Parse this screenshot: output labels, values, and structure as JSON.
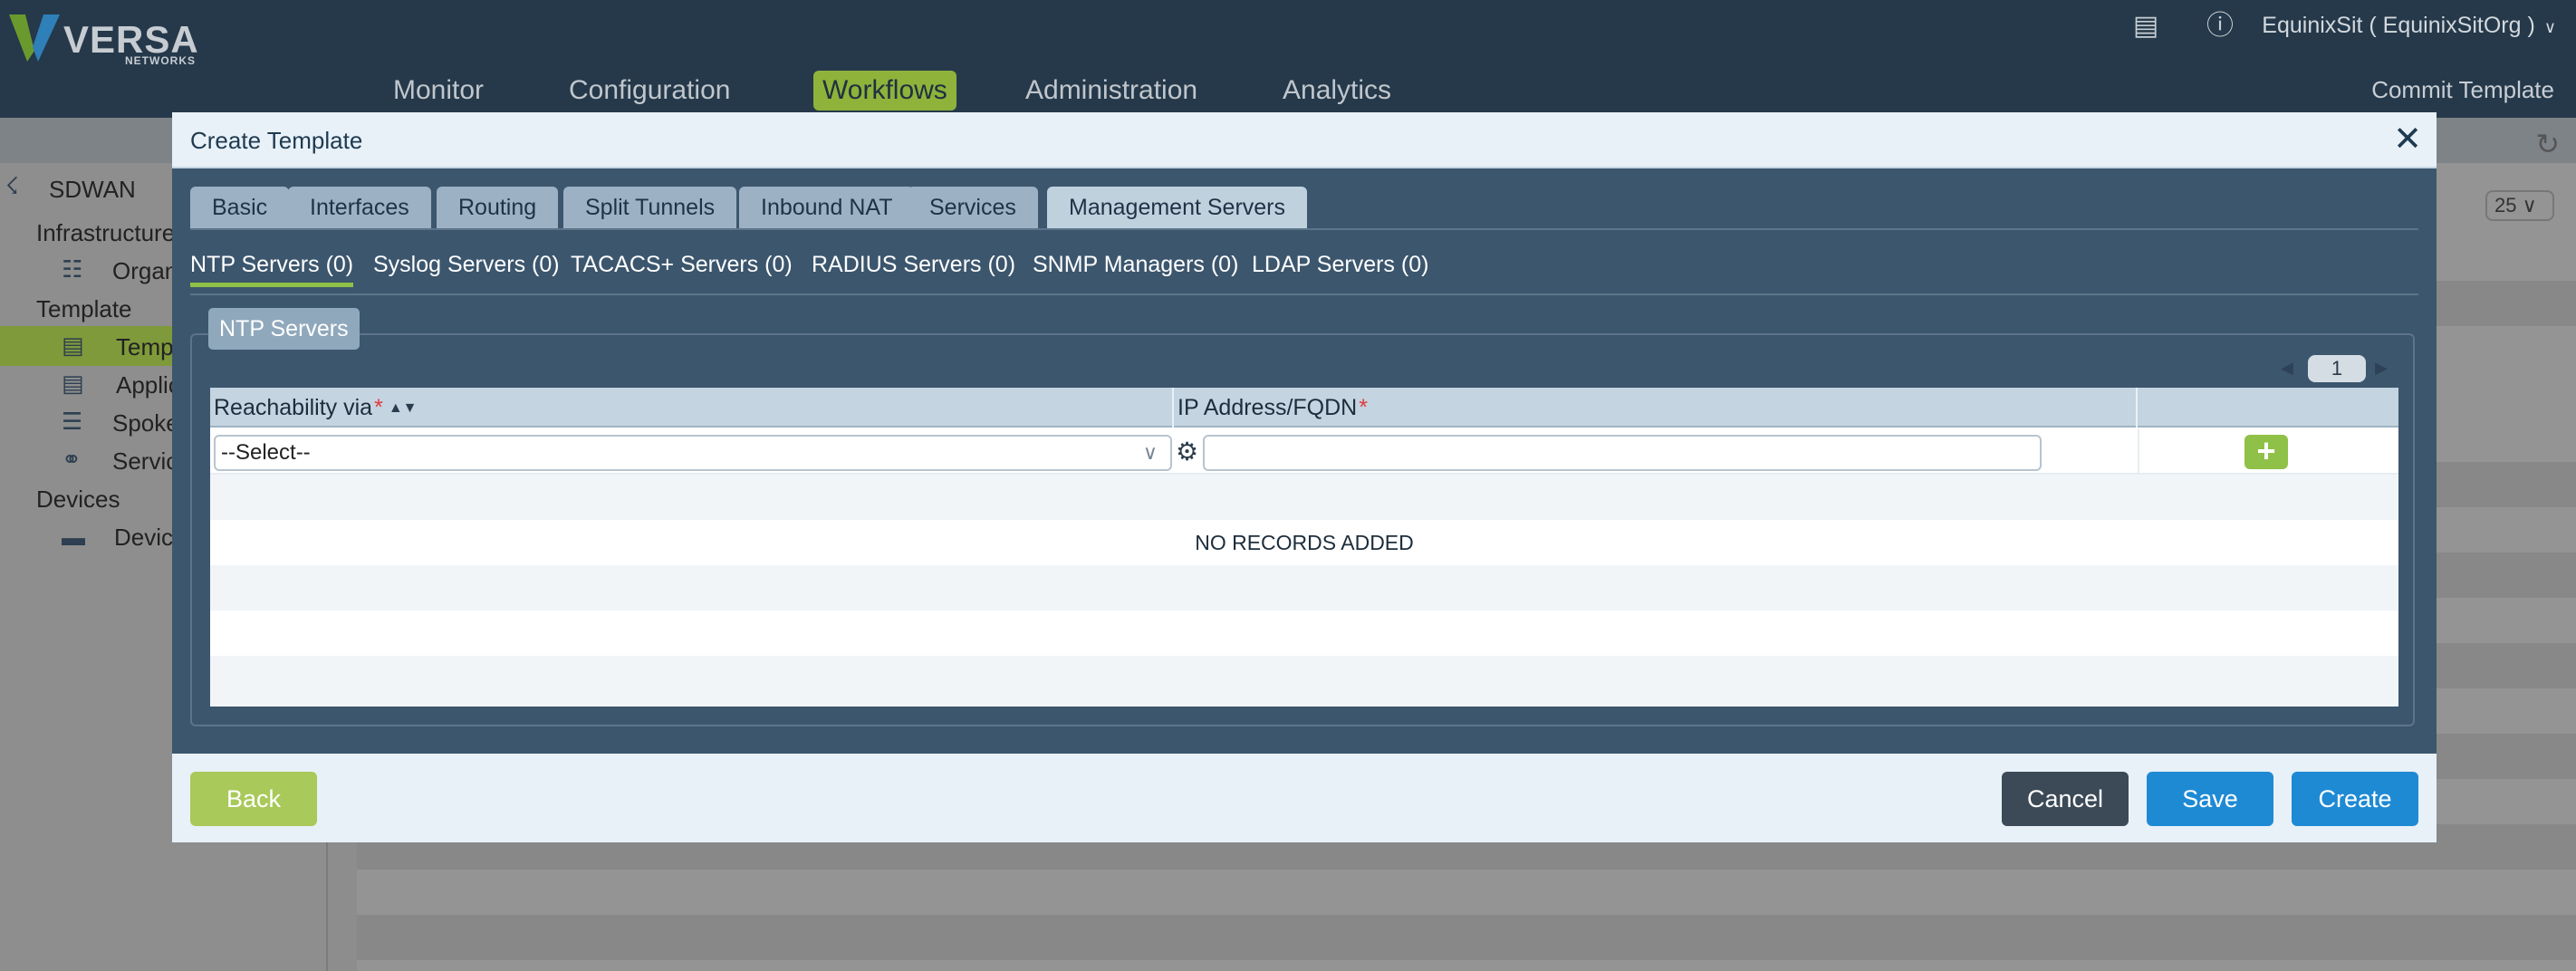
{
  "brand": {
    "name": "VERSA",
    "sub": "NETWORKS"
  },
  "header": {
    "org": "EquinixSit ( EquinixSitOrg )",
    "nav": [
      "Monitor",
      "Configuration",
      "Workflows",
      "Administration",
      "Analytics"
    ],
    "active_nav": "Workflows",
    "commit": "Commit Template"
  },
  "sidebar": {
    "root": "SDWAN",
    "infrastructure": "Infrastructure",
    "organization": "Organ",
    "template": "Template",
    "template_item": "Temp",
    "applic": "Applic",
    "spoke": "Spoke",
    "servic": "Servic",
    "devices": "Devices",
    "device": "Device"
  },
  "background": {
    "page_size": "25"
  },
  "modal": {
    "title": "Create Template",
    "tabs": [
      "Basic",
      "Interfaces",
      "Routing",
      "Split Tunnels",
      "Inbound NAT",
      "Services",
      "Management Servers"
    ],
    "active_tab": "Management Servers",
    "subtabs": [
      "NTP Servers (0)",
      "Syslog Servers (0)",
      "TACACS+ Servers (0)",
      "RADIUS Servers (0)",
      "SNMP Managers (0)",
      "LDAP Servers (0)"
    ],
    "active_subtab": "NTP Servers (0)",
    "section_title": "NTP Servers",
    "pager_page": "1",
    "columns": [
      {
        "label": "Reachability via",
        "required": "*"
      },
      {
        "label": "IP Address/FQDN",
        "required": "*"
      }
    ],
    "select_value": "--Select--",
    "ip_value": "",
    "empty_text": "NO RECORDS ADDED",
    "buttons": {
      "back": "Back",
      "cancel": "Cancel",
      "save": "Save",
      "create": "Create"
    }
  },
  "colors": {
    "topbar": "#25394a",
    "accent_green": "#8fc148",
    "primary_blue": "#1f8ad4",
    "modal_body": "#3c566d"
  }
}
